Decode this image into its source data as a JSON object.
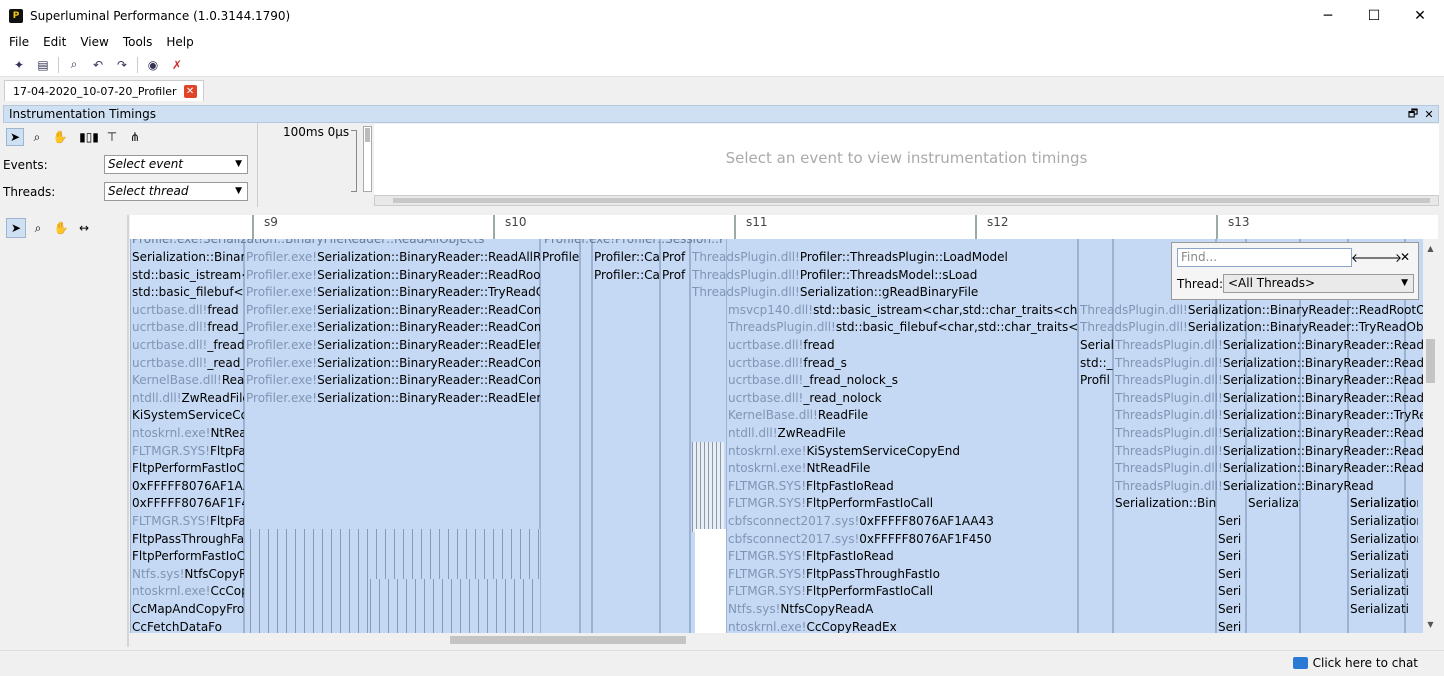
{
  "window": {
    "title": "Superluminal Performance (1.0.3144.1790)",
    "app_icon": "P",
    "minimize": "─",
    "maximize": "☐",
    "close": "✕"
  },
  "menu": [
    "File",
    "Edit",
    "View",
    "Tools",
    "Help"
  ],
  "toolbar_icons": [
    "new-session-icon",
    "open-file-icon",
    "find-icon",
    "attach-icon",
    "run-icon",
    "capture-icon",
    "clear-icon"
  ],
  "tab": {
    "label": "17-04-2020_10-07-20_Profiler",
    "close": "✕"
  },
  "panel": {
    "title": "Instrumentation Timings",
    "restore": "🗗",
    "close": "✕"
  },
  "controls": {
    "events_label": "Events:",
    "events_placeholder": "Select event",
    "threads_label": "Threads:",
    "threads_placeholder": "Select thread",
    "scale": "100ms 0µs"
  },
  "message": "Select an event to view instrumentation timings",
  "ruler_ticks": [
    "s9",
    "s10",
    "s11",
    "s12",
    "s13"
  ],
  "find": {
    "placeholder": "Find...",
    "prev": "🡐",
    "next": "🡒",
    "close": "✕",
    "thread_label": "Thread:",
    "thread_value": "<All Threads>"
  },
  "timeline": {
    "top_clipped": [
      "Profiler.exe!Serialization::BinaryFileReader::ReadAllObjects",
      "Profiler.exe!Profiler::Session::PostLoad"
    ],
    "col1": [
      {
        "m": "",
        "f": "Serialization::Binary"
      },
      {
        "m": "",
        "f": "std::basic_istream<c"
      },
      {
        "m": "",
        "f": "std::basic_filebuf<c"
      },
      {
        "m": "ucrtbase.dll!",
        "f": "fread"
      },
      {
        "m": "ucrtbase.dll!",
        "f": "fread_s"
      },
      {
        "m": "ucrtbase.dll!",
        "f": "_fread_"
      },
      {
        "m": "ucrtbase.dll!",
        "f": "_read_n"
      },
      {
        "m": "KernelBase.dll!",
        "f": "Read"
      },
      {
        "m": "ntdll.dll!",
        "f": "ZwReadFile"
      },
      {
        "m": "",
        "f": "KiSystemServiceCop"
      },
      {
        "m": "ntoskrnl.exe!",
        "f": "NtRead"
      },
      {
        "m": "FLTMGR.SYS!",
        "f": "FltpFas"
      },
      {
        "m": "",
        "f": "FltpPerformFastIoCa"
      },
      {
        "m": "",
        "f": "0xFFFFF8076AF1AA"
      },
      {
        "m": "",
        "f": "0xFFFFF8076AF1F45"
      },
      {
        "m": "FLTMGR.SYS!",
        "f": "FltpFas"
      },
      {
        "m": "",
        "f": "FltpPassThroughFas"
      },
      {
        "m": "",
        "f": "FltpPerformFastIoCa"
      },
      {
        "m": "Ntfs.sys!",
        "f": "NtfsCopyRe"
      },
      {
        "m": "ntoskrnl.exe!",
        "f": "CcCopy"
      },
      {
        "m": "",
        "f": "CcMapAndCopyFro"
      },
      {
        "m": "",
        "f": "CcFetchDataFo"
      }
    ],
    "col2": [
      {
        "m": "Profiler.exe!",
        "f": "Serialization::BinaryReader::ReadAllRoot"
      },
      {
        "m": "Profiler.exe!",
        "f": "Serialization::BinaryReader::ReadRootObj"
      },
      {
        "m": "Profiler.exe!",
        "f": "Serialization::BinaryReader::TryReadObje"
      },
      {
        "m": "Profiler.exe!",
        "f": "Serialization::BinaryReader::ReadCompou"
      },
      {
        "m": "Profiler.exe!",
        "f": "Serialization::BinaryReader::ReadCompou"
      },
      {
        "m": "Profiler.exe!",
        "f": "Serialization::BinaryReader::ReadElement"
      },
      {
        "m": "Profiler.exe!",
        "f": "Serialization::BinaryReader::ReadCompou"
      },
      {
        "m": "Profiler.exe!",
        "f": "Serialization::BinaryReader::ReadCompou"
      },
      {
        "m": "Profiler.exe!",
        "f": "Serialization::BinaryReader::ReadElement"
      }
    ],
    "col3": [
      {
        "m": "",
        "f": "Profile"
      },
      {
        "m": "",
        "f": ""
      }
    ],
    "col4": [
      {
        "m": "",
        "f": "Profiler::Call"
      },
      {
        "m": "",
        "f": "Profiler::Call"
      }
    ],
    "col5": [
      {
        "m": "",
        "f": "Prof"
      },
      {
        "m": "",
        "f": "Prof"
      }
    ],
    "col6_top": [
      {
        "m": "ThreadsPlugin.dll!",
        "f": "Profiler::ThreadsPlugin::LoadModel"
      },
      {
        "m": "ThreadsPlugin.dll!",
        "f": "Profiler::ThreadsModel::sLoad"
      },
      {
        "m": "ThreadsPlugin.dll!",
        "f": "Serialization::gReadBinaryFile"
      }
    ],
    "col7": [
      {
        "m": "msvcp140.dll!",
        "f": "std::basic_istream<char,std::char_traits<char> >::re"
      },
      {
        "m": "ThreadsPlugin.dll!",
        "f": "std::basic_filebuf<char,std::char_traits<char> >"
      },
      {
        "m": "ucrtbase.dll!",
        "f": "fread"
      },
      {
        "m": "ucrtbase.dll!",
        "f": "fread_s"
      },
      {
        "m": "ucrtbase.dll!",
        "f": "_fread_nolock_s"
      },
      {
        "m": "ucrtbase.dll!",
        "f": "_read_nolock"
      },
      {
        "m": "KernelBase.dll!",
        "f": "ReadFile"
      },
      {
        "m": "ntdll.dll!",
        "f": "ZwReadFile"
      },
      {
        "m": "ntoskrnl.exe!",
        "f": "KiSystemServiceCopyEnd"
      },
      {
        "m": "ntoskrnl.exe!",
        "f": "NtReadFile"
      },
      {
        "m": "FLTMGR.SYS!",
        "f": "FltpFastIoRead"
      },
      {
        "m": "FLTMGR.SYS!",
        "f": "FltpPerformFastIoCall"
      },
      {
        "m": "cbfsconnect2017.sys!",
        "f": "0xFFFFF8076AF1AA43"
      },
      {
        "m": "cbfsconnect2017.sys!",
        "f": "0xFFFFF8076AF1F450"
      },
      {
        "m": "FLTMGR.SYS!",
        "f": "FltpFastIoRead"
      },
      {
        "m": "FLTMGR.SYS!",
        "f": "FltpPassThroughFastIo"
      },
      {
        "m": "FLTMGR.SYS!",
        "f": "FltpPerformFastIoCall"
      },
      {
        "m": "Ntfs.sys!",
        "f": "NtfsCopyReadA"
      },
      {
        "m": "ntoskrnl.exe!",
        "f": "CcCopyReadEx"
      }
    ],
    "col8": [
      {
        "m": "",
        "f": "Serial"
      },
      {
        "m": "",
        "f": "std::_"
      },
      {
        "m": "",
        "f": "Profil"
      }
    ],
    "col9_wide": [
      {
        "m": "ThreadsPlugin.dll!",
        "f": "Serialization::BinaryReader::ReadRootObject"
      },
      {
        "m": "ThreadsPlugin.dll!",
        "f": "Serialization::BinaryReader::TryReadObject"
      }
    ],
    "col9": [
      {
        "m": "ThreadsPlugin.dll!",
        "f": "Serialization::BinaryReader::ReadCompo"
      },
      {
        "m": "ThreadsPlugin.dll!",
        "f": "Serialization::BinaryReader::ReadCompo"
      },
      {
        "m": "ThreadsPlugin.dll!",
        "f": "Serialization::BinaryReader::ReadElemen"
      },
      {
        "m": "ThreadsPlugin.dll!",
        "f": "Serialization::BinaryReader::ReadCompo"
      },
      {
        "m": "ThreadsPlugin.dll!",
        "f": "Serialization::BinaryReader::TryReadObje"
      },
      {
        "m": "ThreadsPlugin.dll!",
        "f": "Serialization::BinaryReader::ReadCompo"
      },
      {
        "m": "ThreadsPlugin.dll!",
        "f": "Serialization::BinaryReader::ReadCompo"
      },
      {
        "m": "ThreadsPlugin.dll!",
        "f": "Serialization::BinaryReader::ReadElemen"
      },
      {
        "m": "ThreadsPlugin.dll!",
        "f": "Serialization::BinaryRead"
      }
    ],
    "col9_sub": [
      {
        "m": "",
        "f": "Serialization::Binar"
      },
      {
        "m": "",
        "f": "Serializat"
      },
      {
        "m": "",
        "f": "Serialization::"
      }
    ],
    "col10": [
      "Seri",
      "Seri",
      "Seri",
      "Seri",
      "Seri",
      "Seri",
      "Seri"
    ],
    "col11": [
      "Serialization::",
      "Serialization::",
      "Serialization::",
      "Serializati",
      "Serializati",
      "Serializati",
      "Serializati"
    ]
  },
  "status": {
    "chat": "Click here to chat"
  }
}
